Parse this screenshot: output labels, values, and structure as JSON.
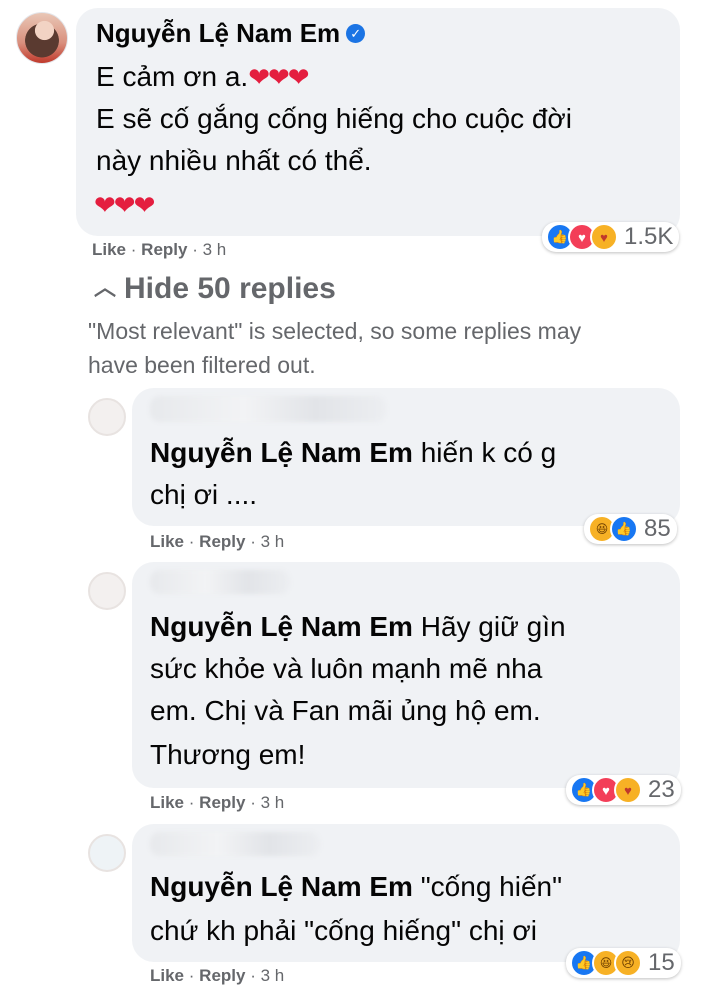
{
  "main_comment": {
    "author": "Nguyễn Lệ Nam Em",
    "line1": "E cảm ơn a.",
    "line1_hearts": "❤❤❤",
    "line2": "E sẽ cố gắng cống hiếng cho cuộc đời",
    "line3": "này nhiều nhất có thể.",
    "line4_hearts": "❤❤❤",
    "like": "Like",
    "reply": "Reply",
    "time": "3 h",
    "reaction_count": "1.5K",
    "reaction_icons": [
      "like-icon",
      "love-icon",
      "care-icon"
    ]
  },
  "hide_replies": "Hide 50 replies",
  "filter_note_line1": "\"Most relevant\" is selected, so some replies may",
  "filter_note_line2": "have been filtered out.",
  "replies": [
    {
      "mention": "Nguyễn Lệ Nam Em",
      "text_line1": "hiến k có g",
      "text_line2": "chị ơi ....",
      "like": "Like",
      "reply": "Reply",
      "time": "3 h",
      "reaction_count": "85",
      "reaction_icons": [
        "haha-icon",
        "like-icon"
      ]
    },
    {
      "mention": "Nguyễn Lệ Nam Em",
      "text_line1": "Hãy giữ gìn",
      "text_line2": "sức khỏe và luôn mạnh mẽ nha",
      "text_line3": "em. Chị và Fan mãi ủng hộ em.",
      "text_line4": "Thương em!",
      "like": "Like",
      "reply": "Reply",
      "time": "3 h",
      "reaction_count": "23",
      "reaction_icons": [
        "like-icon",
        "love-icon",
        "care-icon"
      ]
    },
    {
      "mention": "Nguyễn Lệ Nam Em",
      "text_line1": "\"cống hiến\"",
      "text_line2": "chứ kh phải \"cống hiếng\" chị ơi",
      "like": "Like",
      "reply": "Reply",
      "time": "3 h",
      "reaction_count": "15",
      "reaction_icons": [
        "like-icon",
        "haha-icon",
        "sad-icon"
      ]
    }
  ],
  "colors": {
    "bubble": "#f0f2f5",
    "meta": "#65676b",
    "like_blue": "#1877f2",
    "heart_red": "#e41e3f"
  }
}
